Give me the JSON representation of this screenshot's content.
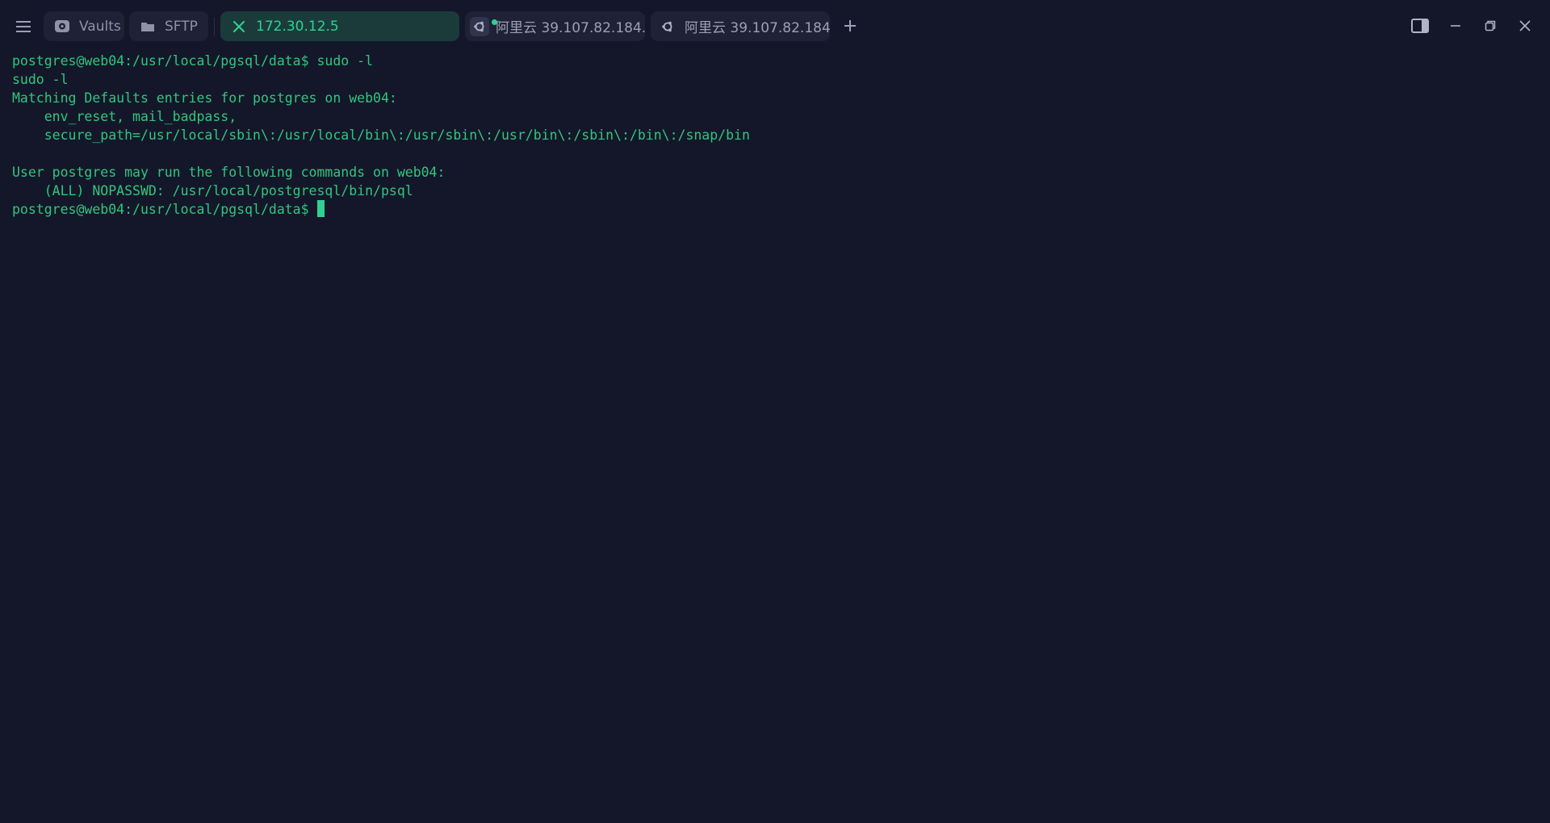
{
  "tabs": [
    {
      "label": "Vaults",
      "icon": "vault-icon",
      "active": false
    },
    {
      "label": "SFTP",
      "icon": "folder-icon",
      "active": false
    },
    {
      "label": "172.30.12.5",
      "icon": "close-icon",
      "active": true
    },
    {
      "label": "阿里云 39.107.82.184...",
      "icon": "ubuntu-icon",
      "active": false
    },
    {
      "label": "阿里云 39.107.82.184...",
      "icon": "ubuntu-icon",
      "active": false
    }
  ],
  "terminal": {
    "lines": [
      "postgres@web04:/usr/local/pgsql/data$ sudo -l",
      "sudo -l",
      "Matching Defaults entries for postgres on web04:",
      "    env_reset, mail_badpass,",
      "    secure_path=/usr/local/sbin\\:/usr/local/bin\\:/usr/sbin\\:/usr/bin\\:/sbin\\:/bin\\:/snap/bin",
      "",
      "User postgres may run the following commands on web04:",
      "    (ALL) NOPASSWD: /usr/local/postgresql/bin/psql",
      "postgres@web04:/usr/local/pgsql/data$ "
    ]
  },
  "colors": {
    "background": "#141729",
    "terminal_text": "#2fc77e",
    "accent": "#2fd193",
    "active_tab_bg": "#1b3b3b"
  }
}
